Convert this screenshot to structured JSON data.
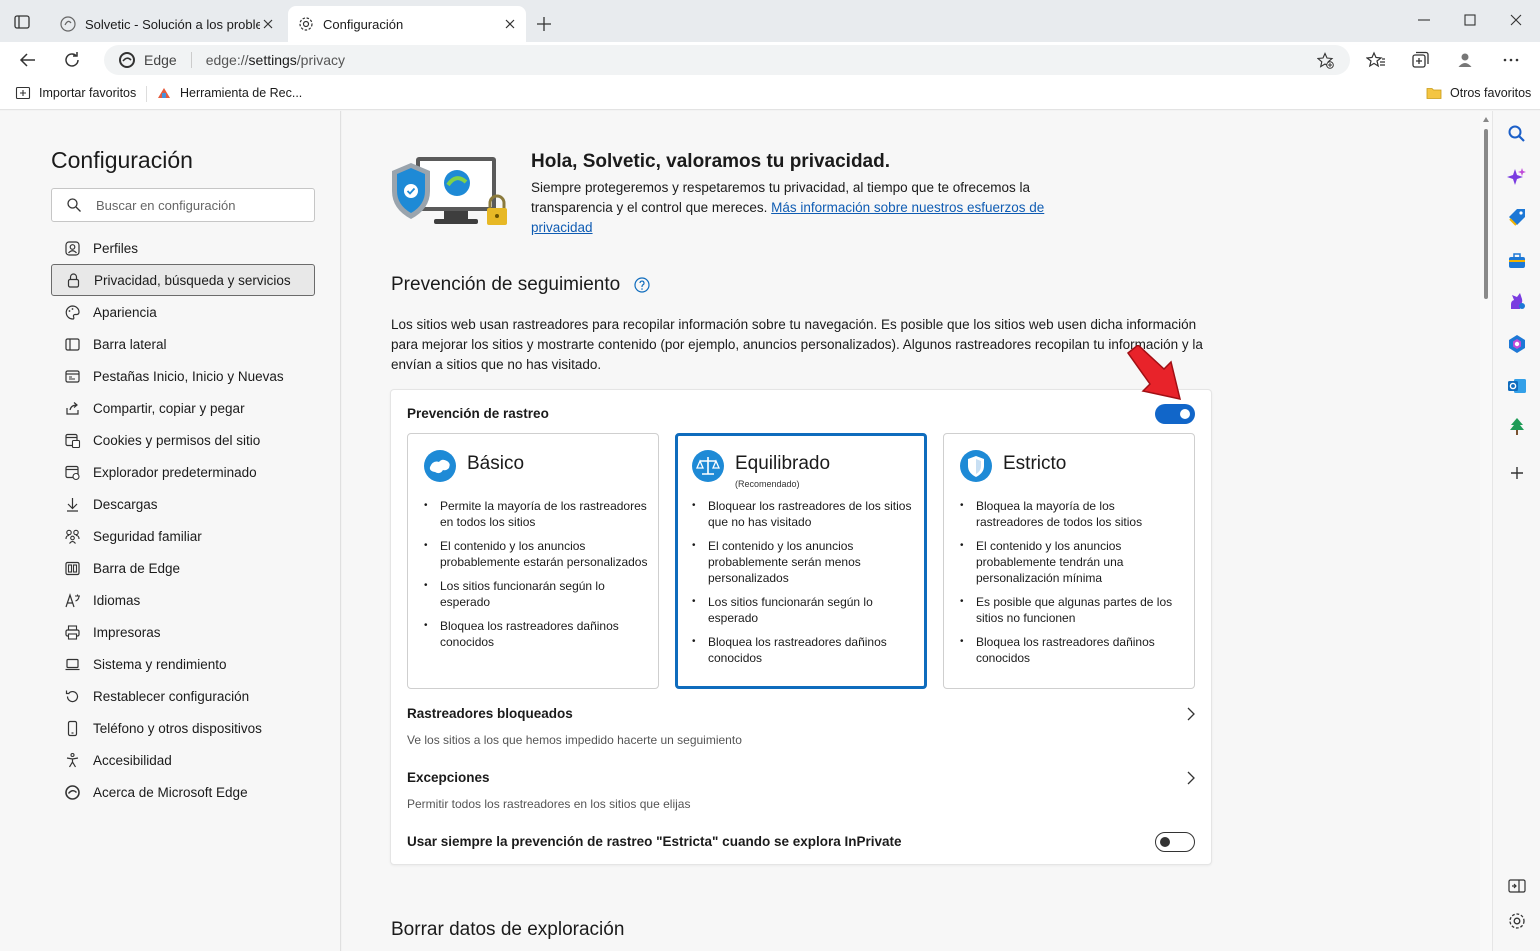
{
  "browser": {
    "tabs": [
      {
        "title": "Solvetic - Solución a los problem"
      },
      {
        "title": "Configuración"
      }
    ],
    "address": {
      "site_label": "Edge",
      "url_prefix": "edge://",
      "url_path": "settings",
      "url_rest": "/privacy"
    },
    "favorites": [
      {
        "label": "Importar favoritos"
      },
      {
        "label": "Herramienta de Rec..."
      }
    ],
    "other_favorites": "Otros favoritos"
  },
  "settings": {
    "title": "Configuración",
    "search_placeholder": "Buscar en configuración",
    "menu": [
      {
        "label": "Perfiles",
        "icon": "profile-icon"
      },
      {
        "label": "Privacidad, búsqueda y servicios",
        "icon": "lock-icon",
        "active": true
      },
      {
        "label": "Apariencia",
        "icon": "palette-icon"
      },
      {
        "label": "Barra lateral",
        "icon": "sidebar-icon"
      },
      {
        "label": "Pestañas Inicio, Inicio y Nuevas",
        "icon": "home-tabs-icon"
      },
      {
        "label": "Compartir, copiar y pegar",
        "icon": "share-icon"
      },
      {
        "label": "Cookies y permisos del sitio",
        "icon": "cookies-icon"
      },
      {
        "label": "Explorador predeterminado",
        "icon": "browser-icon"
      },
      {
        "label": "Descargas",
        "icon": "download-icon"
      },
      {
        "label": "Seguridad familiar",
        "icon": "family-icon"
      },
      {
        "label": "Barra de Edge",
        "icon": "edge-bar-icon"
      },
      {
        "label": "Idiomas",
        "icon": "languages-icon"
      },
      {
        "label": "Impresoras",
        "icon": "printer-icon"
      },
      {
        "label": "Sistema y rendimiento",
        "icon": "laptop-icon"
      },
      {
        "label": "Restablecer configuración",
        "icon": "reset-icon"
      },
      {
        "label": "Teléfono y otros dispositivos",
        "icon": "phone-icon"
      },
      {
        "label": "Accesibilidad",
        "icon": "accessibility-icon"
      },
      {
        "label": "Acerca de Microsoft Edge",
        "icon": "edge-icon"
      }
    ]
  },
  "privacy": {
    "hero_title": "Hola, Solvetic, valoramos tu privacidad.",
    "hero_text": "Siempre protegeremos y respetaremos tu privacidad, al tiempo que te ofrecemos la transparencia y el control que mereces.",
    "hero_link": "Más información sobre nuestros esfuerzos de privacidad",
    "section_title": "Prevención de seguimiento",
    "section_desc": "Los sitios web usan rastreadores para recopilar información sobre tu navegación. Es posible que los sitios web usen dicha información para mejorar los sitios y mostrarte contenido (por ejemplo, anuncios personalizados). Algunos rastreadores recopilan tu información y la envían a sitios que no has visitado.",
    "tracking_label": "Prevención de rastreo",
    "tracking_enabled": true,
    "options": [
      {
        "title": "Básico",
        "subtitle": "",
        "bullets": [
          "Permite la mayoría de los rastreadores en todos los sitios",
          "El contenido y los anuncios probablemente estarán personalizados",
          "Los sitios funcionarán según lo esperado",
          "Bloquea los rastreadores dañinos conocidos"
        ]
      },
      {
        "title": "Equilibrado",
        "subtitle": "(Recomendado)",
        "selected": true,
        "bullets": [
          "Bloquear los rastreadores de los sitios que no has visitado",
          "El contenido y los anuncios probablemente serán menos personalizados",
          "Los sitios funcionarán según lo esperado",
          "Bloquea los rastreadores dañinos conocidos"
        ]
      },
      {
        "title": "Estricto",
        "subtitle": "",
        "bullets": [
          "Bloquea la mayoría de los rastreadores de todos los sitios",
          "El contenido y los anuncios probablemente tendrán una personalización mínima",
          "Es posible que algunas partes de los sitios no funcionen",
          "Bloquea los rastreadores dañinos conocidos"
        ]
      }
    ],
    "blocked_title": "Rastreadores bloqueados",
    "blocked_desc": "Ve los sitios a los que hemos impedido hacerte un seguimiento",
    "exceptions_title": "Excepciones",
    "exceptions_desc": "Permitir todos los rastreadores en los sitios que elijas",
    "inprivate_label": "Usar siempre la prevención de rastreo \"Estricta\" cuando se explora InPrivate",
    "inprivate_enabled": false,
    "next_section": "Borrar datos de exploración"
  },
  "colors": {
    "accent": "#0f6cbd",
    "toggle_on": "#1166c9",
    "annotation_arrow": "#e8232a"
  }
}
